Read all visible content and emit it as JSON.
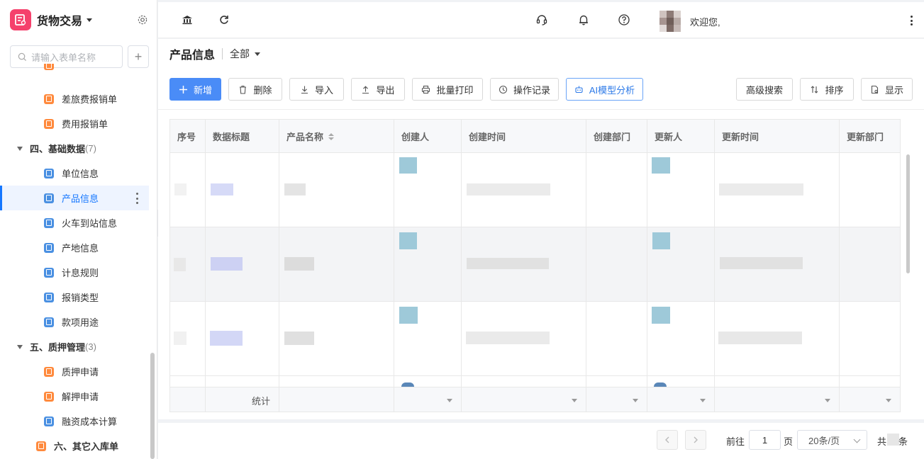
{
  "app": {
    "title": "货物交易"
  },
  "sidebar": {
    "search_placeholder": "请输入表单名称",
    "add_label": "+",
    "items": [
      {
        "label": "差旅费报销单",
        "icon": "orange"
      },
      {
        "label": "费用报销单",
        "icon": "orange"
      },
      {
        "label": "四、基础数据",
        "count": "(7)",
        "group": true
      },
      {
        "label": "单位信息",
        "icon": "blue"
      },
      {
        "label": "产品信息",
        "icon": "blue",
        "active": true
      },
      {
        "label": "火车到站信息",
        "icon": "blue"
      },
      {
        "label": "产地信息",
        "icon": "blue"
      },
      {
        "label": "计息规则",
        "icon": "blue"
      },
      {
        "label": "报销类型",
        "icon": "blue"
      },
      {
        "label": "款项用途",
        "icon": "blue"
      },
      {
        "label": "五、质押管理",
        "count": "(3)",
        "group": true
      },
      {
        "label": "质押申请",
        "icon": "orange"
      },
      {
        "label": "解押申请",
        "icon": "orange"
      },
      {
        "label": "融资成本计算",
        "icon": "blue"
      },
      {
        "label": "六、其它入库单",
        "icon": "orange",
        "bold": true
      }
    ]
  },
  "topbar": {
    "welcome": "欢迎您,"
  },
  "page": {
    "title": "产品信息",
    "filter": "全部"
  },
  "toolbar": {
    "new": "新增",
    "delete": "删除",
    "import": "导入",
    "export": "导出",
    "batch_print": "批量打印",
    "log": "操作记录",
    "ai": "AI模型分析",
    "advanced_search": "高级搜索",
    "sort": "排序",
    "display": "显示"
  },
  "table": {
    "columns": [
      "序号",
      "数据标题",
      "产品名称",
      "创建人",
      "创建时间",
      "创建部门",
      "更新人",
      "更新时间",
      "更新部门"
    ],
    "stat_label": "统计"
  },
  "pager": {
    "goto": "前往",
    "page_value": "1",
    "page_unit": "页",
    "page_size": "20条/页",
    "total_prefix": "共",
    "total_suffix": "条"
  },
  "colors": {
    "primary": "#4a8cf7",
    "active_text": "#1677ff",
    "logo": "#f5416c"
  }
}
